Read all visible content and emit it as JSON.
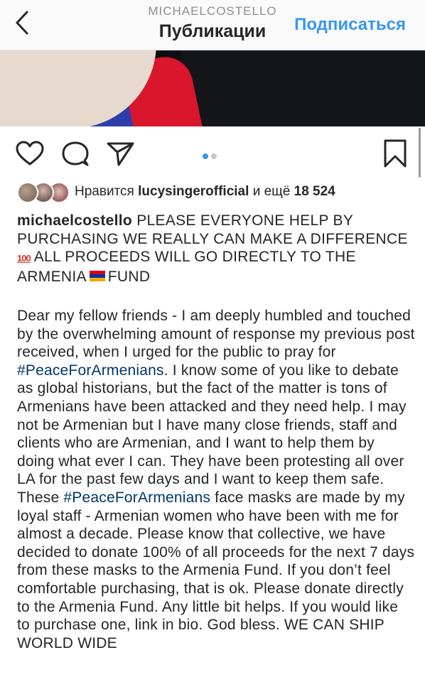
{
  "header": {
    "username": "MICHAELCOSTELLO",
    "title": "Публикации",
    "follow_label": "Подписаться",
    "back_icon": "chevron-left-icon"
  },
  "post": {
    "carousel": {
      "total": 2,
      "active": 1
    },
    "actions": [
      "heart-icon",
      "comment-icon",
      "share-icon",
      "bookmark-icon"
    ],
    "likes": {
      "prefix": "Нравится",
      "user": "lucysingerofficial",
      "middle": "и ещё",
      "count": "18 524"
    },
    "caption": {
      "author": "michaelcostello",
      "text_part1": "PLEASE EVERYONE HELP BY PURCHASING WE REALLY CAN MAKE A DIFFERENCE",
      "emoji_100": "100",
      "text_part2": "ALL PROCEEDS WILL GO DIRECTLY TO THE ARMENIA",
      "text_part3": "FUND",
      "flag_colors": [
        "#d90012",
        "#0033a0",
        "#f2a800"
      ]
    },
    "body": {
      "p1": "Dear my fellow friends - I am deeply humbled and touched by the overwhelming amount of response my previous post received, when I urged for the public to pray for",
      "hashtag1": "#PeaceForArmenians",
      "p2": ". I know some of you like to debate as global historians, but the fact of the matter is tons of Armenians have been attacked and they need help. I may not be Armenian but I have many close friends, staff and clients  who are Armenian, and I want to help them by doing what ever  I can. They have been protesting all over LA for the past few days and I want to keep them safe. These",
      "hashtag2": "#PeaceForArmenians",
      "p3": "face masks are made by my loyal staff - Armenian women who have been with me for almost a decade. Please know that collective, we have decided to donate 100% of all proceeds for the next 7 days from these masks to the Armenia Fund. If you don’t feel comfortable purchasing, that is ok. Please donate directly to the Armenia Fund. Any little bit helps. If you would like to purchase one, link in bio. God bless. WE CAN SHIP WORLD WIDE"
    }
  },
  "colors": {
    "accent": "#3897f0",
    "hashtag": "#003569",
    "text": "#262626",
    "muted": "#8e8e8e"
  }
}
